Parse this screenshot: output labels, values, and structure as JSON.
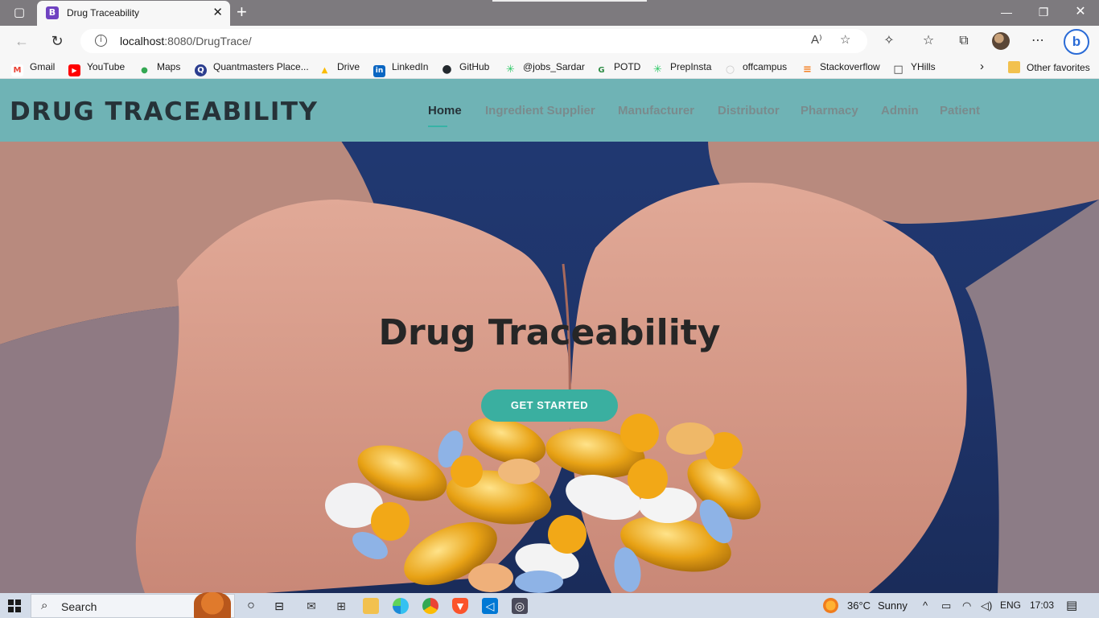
{
  "browser": {
    "tab_title": "Drug Traceability",
    "tab_favicon": "B",
    "url_host": "localhost",
    "url_rest": ":8080/DrugTrace/",
    "bookmarks": [
      {
        "label": "Gmail",
        "icon": "M",
        "color": "#ea4335"
      },
      {
        "label": "YouTube",
        "icon": "▶",
        "color": "#ff0000"
      },
      {
        "label": "Maps",
        "icon": "●",
        "color": "#34a853"
      },
      {
        "label": "Quantmasters Place...",
        "icon": "Q",
        "color": "#2c3e8f"
      },
      {
        "label": "Drive",
        "icon": "▲",
        "color": "#fbbc04"
      },
      {
        "label": "LinkedIn",
        "icon": "in",
        "color": "#0a66c2"
      },
      {
        "label": "GitHub",
        "icon": "●",
        "color": "#24292e"
      },
      {
        "label": "@jobs_Sardar",
        "icon": "✳",
        "color": "#2ec866"
      },
      {
        "label": "POTD",
        "icon": "G",
        "color": "#2f8d46"
      },
      {
        "label": "PrepInsta",
        "icon": "✳",
        "color": "#2ec866"
      },
      {
        "label": "offcampus",
        "icon": "○",
        "color": "#e0e0e0"
      },
      {
        "label": "Stackoverflow",
        "icon": "≡",
        "color": "#f48024"
      },
      {
        "label": "YHills",
        "icon": "□",
        "color": "#ffffff"
      }
    ],
    "other_favorites": "Other favorites"
  },
  "site": {
    "brand": "DRUG TRACEABILITY",
    "nav": [
      "Home",
      "Ingredient Supplier",
      "Manufacturer",
      "Distributor",
      "Pharmacy",
      "Admin",
      "Patient"
    ],
    "active_nav": "Home",
    "hero_title": "Drug Traceability",
    "cta_label": "GET STARTED"
  },
  "taskbar": {
    "search_label": "Search",
    "temperature": "36°C",
    "weather": "Sunny",
    "language": "ENG",
    "time": "17:03"
  }
}
